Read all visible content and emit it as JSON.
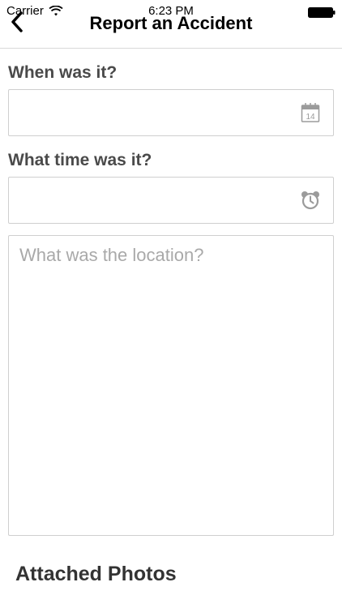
{
  "status_bar": {
    "carrier": "Carrier",
    "time": "6:23 PM",
    "wifi_icon": "wifi-icon",
    "battery_icon": "battery-icon"
  },
  "nav": {
    "title": "Report an Accident",
    "back_icon": "chevron-left-icon"
  },
  "form": {
    "date_label": "When was it?",
    "date_value": "",
    "date_icon": "calendar-icon",
    "calendar_day": "14",
    "time_label": "What time was it?",
    "time_value": "",
    "time_icon": "alarm-clock-icon",
    "location_placeholder": "What was the location?",
    "location_value": ""
  },
  "photos": {
    "heading": "Attached Photos"
  },
  "colors": {
    "label": "#4a4a4a",
    "border": "#cfcfcf",
    "placeholder": "#a9a9a9",
    "icon": "#9b9b9b"
  }
}
